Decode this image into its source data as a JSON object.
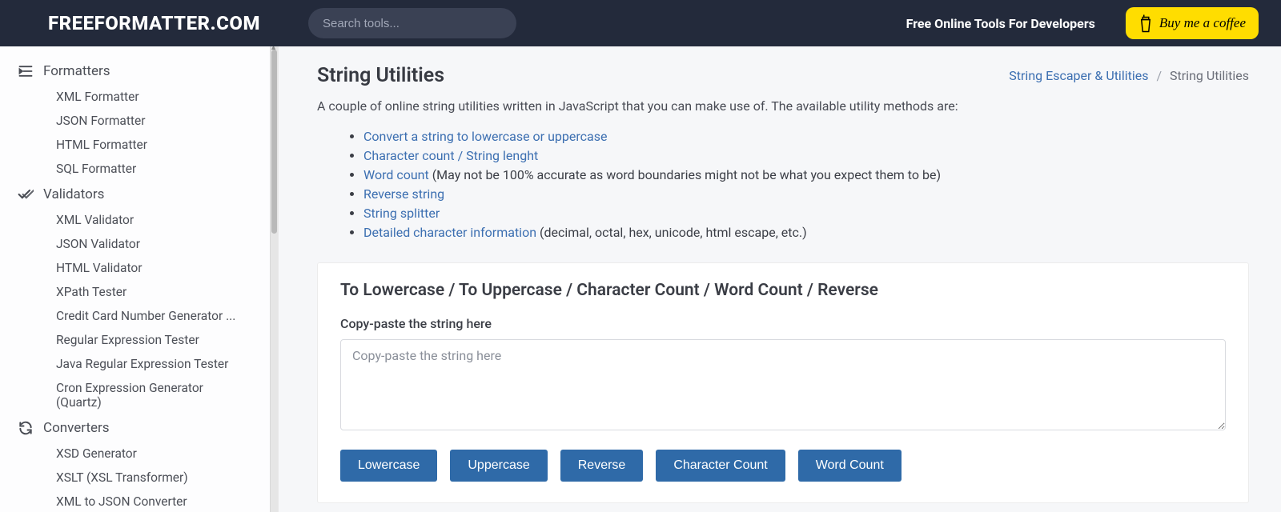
{
  "header": {
    "logo": "FREEFORMATTER.COM",
    "search_placeholder": "Search tools...",
    "tagline": "Free Online Tools For Developers",
    "coffee_label": "Buy me a coffee"
  },
  "sidebar": {
    "groups": [
      {
        "label": "Formatters",
        "icon": "indent-icon",
        "items": [
          "XML Formatter",
          "JSON Formatter",
          "HTML Formatter",
          "SQL Formatter"
        ]
      },
      {
        "label": "Validators",
        "icon": "check-double-icon",
        "items": [
          "XML Validator",
          "JSON Validator",
          "HTML Validator",
          "XPath Tester",
          "Credit Card Number Generator ...",
          "Regular Expression Tester",
          "Java Regular Expression Tester",
          "Cron Expression Generator (Quartz)"
        ]
      },
      {
        "label": "Converters",
        "icon": "refresh-icon",
        "items": [
          "XSD Generator",
          "XSLT (XSL Transformer)",
          "XML to JSON Converter"
        ]
      }
    ]
  },
  "breadcrumb": {
    "parent": "String Escaper & Utilities",
    "current": "String Utilities"
  },
  "page": {
    "title": "String Utilities",
    "intro": "A couple of online string utilities written in JavaScript that you can make use of. The available utility methods are:",
    "features": [
      {
        "link": "Convert a string to lowercase or uppercase",
        "rest": ""
      },
      {
        "link": "Character count / String lenght",
        "rest": ""
      },
      {
        "link": "Word count",
        "rest": " (May not be 100% accurate as word boundaries might not be what you expect them to be)"
      },
      {
        "link": "Reverse string",
        "rest": ""
      },
      {
        "link": "String splitter",
        "rest": ""
      },
      {
        "link": "Detailed character information",
        "rest": " (decimal, octal, hex, unicode, html escape, etc.)"
      }
    ]
  },
  "tool": {
    "heading": "To Lowercase / To Uppercase / Character Count / Word Count / Reverse",
    "field_label": "Copy-paste the string here",
    "placeholder": "Copy-paste the string here",
    "buttons": [
      "Lowercase",
      "Uppercase",
      "Reverse",
      "Character Count",
      "Word Count"
    ]
  }
}
